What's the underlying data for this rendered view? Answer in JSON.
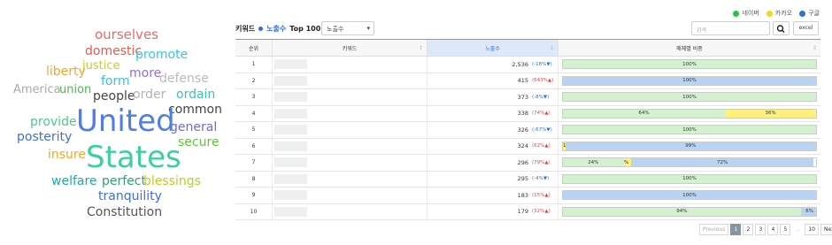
{
  "word_cloud": [
    {
      "text": "ourselves",
      "color": "#ee6a6a"
    },
    {
      "text": "domestic",
      "color": "#e95a4a"
    },
    {
      "text": "promote",
      "color": "#35c6e8"
    },
    {
      "text": "justice",
      "color": "#c7cf2d"
    },
    {
      "text": "liberty",
      "color": "#f4a62c"
    },
    {
      "text": "more",
      "color": "#8c6ee6"
    },
    {
      "text": "defense",
      "color": "#bbbbbb"
    },
    {
      "text": "form",
      "color": "#38bfe6"
    },
    {
      "text": "America",
      "color": "#aaaaaa"
    },
    {
      "text": "union",
      "color": "#48b84c"
    },
    {
      "text": "people",
      "color": "#444444"
    },
    {
      "text": "order",
      "color": "#b3b3b3"
    },
    {
      "text": "ordain",
      "color": "#40c0b0"
    },
    {
      "text": "common",
      "color": "#444444"
    },
    {
      "text": "United",
      "color": "#4f7ee6"
    },
    {
      "text": "provide",
      "color": "#4ccb8a"
    },
    {
      "text": "general",
      "color": "#6a6ae6"
    },
    {
      "text": "posterity",
      "color": "#3f6fd8"
    },
    {
      "text": "secure",
      "color": "#5cc83c"
    },
    {
      "text": "insure",
      "color": "#f4a62c"
    },
    {
      "text": "States",
      "color": "#3ecfa0"
    },
    {
      "text": "welfare",
      "color": "#22a8a8"
    },
    {
      "text": "perfect",
      "color": "#32a074"
    },
    {
      "text": "blessings",
      "color": "#b9cf2a"
    },
    {
      "text": "tranquility",
      "color": "#3f6fd8"
    },
    {
      "text": "Constitution",
      "color": "#555555"
    }
  ],
  "legend": [
    {
      "label": "네이버",
      "color": "#27c24c"
    },
    {
      "label": "카카오",
      "color": "#f6d32a"
    },
    {
      "label": "구글",
      "color": "#2f6fd8"
    }
  ],
  "header": {
    "keyword_label": "키워드",
    "metric_label": "노출수",
    "top_label": "Top 100",
    "select_value": "노출수",
    "search_placeholder": "검색",
    "excel_label": "excel"
  },
  "table": {
    "columns": [
      "순위",
      "키워드",
      "노출수",
      "매체별 비중"
    ],
    "rows": [
      {
        "rank": "1",
        "count": "2,536",
        "change": "(-18%▼)",
        "dir": "down",
        "segments": [
          {
            "type": "n",
            "pct": 100,
            "label": "100%"
          }
        ]
      },
      {
        "rank": "2",
        "count": "415",
        "change": "(643%▲)",
        "dir": "up",
        "segments": [
          {
            "type": "g",
            "pct": 100,
            "label": "100%"
          }
        ]
      },
      {
        "rank": "3",
        "count": "373",
        "change": "(-8%▼)",
        "dir": "down",
        "segments": [
          {
            "type": "n",
            "pct": 100,
            "label": "100%"
          }
        ]
      },
      {
        "rank": "4",
        "count": "338",
        "change": "(74%▲)",
        "dir": "up",
        "segments": [
          {
            "type": "n",
            "pct": 64,
            "label": "64%"
          },
          {
            "type": "k",
            "pct": 36,
            "label": "36%"
          }
        ]
      },
      {
        "rank": "5",
        "count": "326",
        "change": "(-67%▼)",
        "dir": "down",
        "segments": [
          {
            "type": "n",
            "pct": 100,
            "label": "100%"
          }
        ]
      },
      {
        "rank": "6",
        "count": "324",
        "change": "(62%▲)",
        "dir": "up",
        "segments": [
          {
            "type": "k",
            "pct": 1,
            "label": "1"
          },
          {
            "type": "g",
            "pct": 99,
            "label": "99%"
          }
        ]
      },
      {
        "rank": "7",
        "count": "296",
        "change": "(79%▲)",
        "dir": "up",
        "segments": [
          {
            "type": "n",
            "pct": 24,
            "label": "24%"
          },
          {
            "type": "k",
            "pct": 3,
            "label": "3%"
          },
          {
            "type": "g",
            "pct": 72,
            "label": "72%"
          }
        ]
      },
      {
        "rank": "8",
        "count": "295",
        "change": "(-4%▼)",
        "dir": "down",
        "segments": [
          {
            "type": "n",
            "pct": 100,
            "label": "100%"
          }
        ]
      },
      {
        "rank": "9",
        "count": "183",
        "change": "(15%▲)",
        "dir": "up",
        "segments": [
          {
            "type": "g",
            "pct": 100,
            "label": "100%"
          }
        ]
      },
      {
        "rank": "10",
        "count": "179",
        "change": "(32%▲)",
        "dir": "up",
        "segments": [
          {
            "type": "n",
            "pct": 94,
            "label": "94%"
          },
          {
            "type": "g",
            "pct": 6,
            "label": "6%"
          }
        ]
      }
    ]
  },
  "pagination": {
    "previous": "Previous",
    "pages": [
      "1",
      "2",
      "3",
      "4",
      "5"
    ],
    "ellipsis": "...",
    "last": "10",
    "next": "Next",
    "current": "1"
  }
}
